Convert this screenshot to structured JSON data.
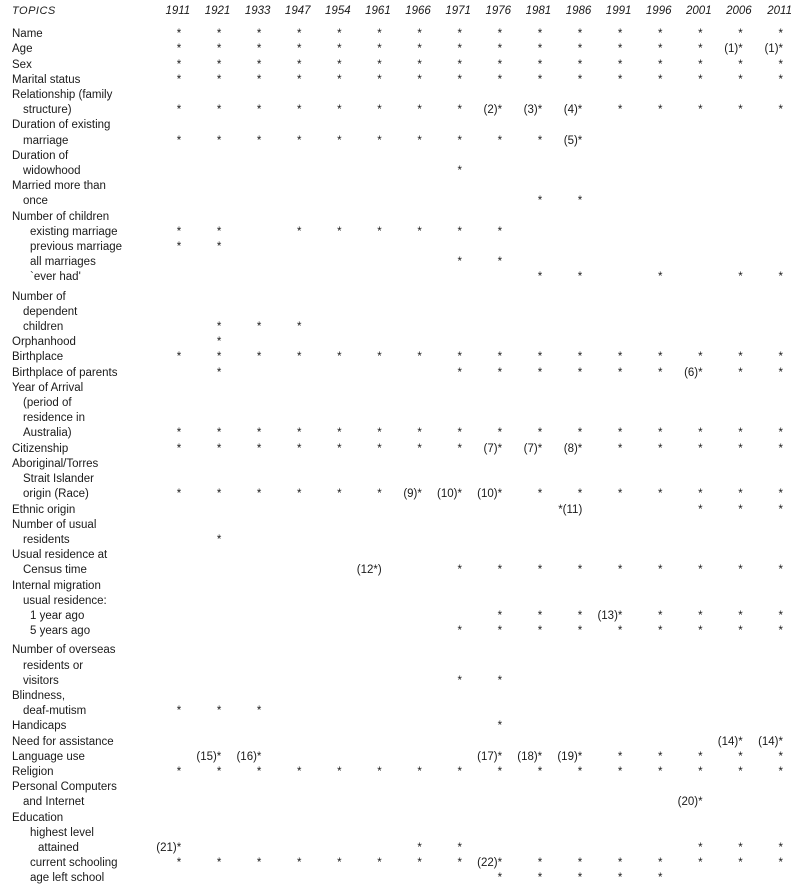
{
  "header": {
    "topics_label": "TOPICS",
    "years": [
      "1911",
      "1921",
      "1933",
      "1947",
      "1954",
      "1961",
      "1966",
      "1971",
      "1976",
      "1981",
      "1986",
      "1991",
      "1996",
      "2001",
      "2006",
      "2011"
    ]
  },
  "rows": [
    {
      "label": "Name",
      "indent": 0,
      "values": [
        "*",
        "*",
        "*",
        "*",
        "*",
        "*",
        "*",
        "*",
        "*",
        "*",
        "*",
        "*",
        "*",
        "*",
        "*",
        "*"
      ]
    },
    {
      "label": "Age",
      "indent": 0,
      "values": [
        "*",
        "*",
        "*",
        "*",
        "*",
        "*",
        "*",
        "*",
        "*",
        "*",
        "*",
        "*",
        "*",
        "*",
        "(1)*",
        "(1)*"
      ]
    },
    {
      "label": "Sex",
      "indent": 0,
      "values": [
        "*",
        "*",
        "*",
        "*",
        "*",
        "*",
        "*",
        "*",
        "*",
        "*",
        "*",
        "*",
        "*",
        "*",
        "*",
        "*"
      ]
    },
    {
      "label": "Marital status",
      "indent": 0,
      "values": [
        "*",
        "*",
        "*",
        "*",
        "*",
        "*",
        "*",
        "*",
        "*",
        "*",
        "*",
        "*",
        "*",
        "*",
        "*",
        "*"
      ]
    },
    {
      "label": "Relationship (family",
      "indent": 0,
      "values": [
        "",
        "",
        "",
        "",
        "",
        "",
        "",
        "",
        "",
        "",
        "",
        "",
        "",
        "",
        "",
        ""
      ]
    },
    {
      "label": "structure)",
      "indent": 1,
      "values": [
        "*",
        "*",
        "*",
        "*",
        "*",
        "*",
        "*",
        "*",
        "(2)*",
        "(3)*",
        "(4)*",
        "*",
        "*",
        "*",
        "*",
        "*"
      ]
    },
    {
      "label": "Duration of existing",
      "indent": 0,
      "values": [
        "",
        "",
        "",
        "",
        "",
        "",
        "",
        "",
        "",
        "",
        "",
        "",
        "",
        "",
        "",
        ""
      ]
    },
    {
      "label": "marriage",
      "indent": 1,
      "values": [
        "*",
        "*",
        "*",
        "*",
        "*",
        "*",
        "*",
        "*",
        "*",
        "*",
        "(5)*",
        "",
        "",
        "",
        "",
        ""
      ]
    },
    {
      "label": "Duration of",
      "indent": 0,
      "values": [
        "",
        "",
        "",
        "",
        "",
        "",
        "",
        "",
        "",
        "",
        "",
        "",
        "",
        "",
        "",
        ""
      ]
    },
    {
      "label": "widowhood",
      "indent": 1,
      "values": [
        "",
        "",
        "",
        "",
        "",
        "",
        "",
        "*",
        "",
        "",
        "",
        "",
        "",
        "",
        "",
        ""
      ]
    },
    {
      "label": "Married more than",
      "indent": 0,
      "values": [
        "",
        "",
        "",
        "",
        "",
        "",
        "",
        "",
        "",
        "",
        "",
        "",
        "",
        "",
        "",
        ""
      ]
    },
    {
      "label": "once",
      "indent": 1,
      "values": [
        "",
        "",
        "",
        "",
        "",
        "",
        "",
        "",
        "",
        "*",
        "*",
        "",
        "",
        "",
        "",
        ""
      ]
    },
    {
      "label": "Number of children",
      "indent": 0,
      "values": [
        "",
        "",
        "",
        "",
        "",
        "",
        "",
        "",
        "",
        "",
        "",
        "",
        "",
        "",
        "",
        ""
      ]
    },
    {
      "label": "existing marriage",
      "indent": 2,
      "values": [
        "*",
        "*",
        "",
        "*",
        "*",
        "*",
        "*",
        "*",
        "*",
        "",
        "",
        "",
        "",
        "",
        "",
        ""
      ]
    },
    {
      "label": "previous marriage",
      "indent": 2,
      "values": [
        "*",
        "*",
        "",
        "",
        "",
        "",
        "",
        "",
        "",
        "",
        "",
        "",
        "",
        "",
        "",
        ""
      ]
    },
    {
      "label": "all marriages",
      "indent": 2,
      "values": [
        "",
        "",
        "",
        "",
        "",
        "",
        "",
        "*",
        "*",
        "",
        "",
        "",
        "",
        "",
        "",
        ""
      ]
    },
    {
      "label": "`ever had'",
      "indent": 2,
      "values": [
        "",
        "",
        "",
        "",
        "",
        "",
        "",
        "",
        "",
        "*",
        "*",
        "",
        "*",
        "",
        "*",
        "*"
      ]
    },
    {
      "label": "Number of",
      "indent": 0,
      "gap": true,
      "values": [
        "",
        "",
        "",
        "",
        "",
        "",
        "",
        "",
        "",
        "",
        "",
        "",
        "",
        "",
        "",
        ""
      ]
    },
    {
      "label": "dependent",
      "indent": 1,
      "values": [
        "",
        "",
        "",
        "",
        "",
        "",
        "",
        "",
        "",
        "",
        "",
        "",
        "",
        "",
        "",
        ""
      ]
    },
    {
      "label": "children",
      "indent": 1,
      "values": [
        "",
        "*",
        "*",
        "*",
        "",
        "",
        "",
        "",
        "",
        "",
        "",
        "",
        "",
        "",
        "",
        ""
      ]
    },
    {
      "label": "Orphanhood",
      "indent": 0,
      "values": [
        "",
        "*",
        "",
        "",
        "",
        "",
        "",
        "",
        "",
        "",
        "",
        "",
        "",
        "",
        "",
        ""
      ]
    },
    {
      "label": "Birthplace",
      "indent": 0,
      "values": [
        "*",
        "*",
        "*",
        "*",
        "*",
        "*",
        "*",
        "*",
        "*",
        "*",
        "*",
        "*",
        "*",
        "*",
        "*",
        "*"
      ]
    },
    {
      "label": "Birthplace of parents",
      "indent": 0,
      "values": [
        "",
        "*",
        "",
        "",
        "",
        "",
        "",
        "*",
        "*",
        "*",
        "*",
        "*",
        "*",
        "(6)*",
        "*",
        "*"
      ]
    },
    {
      "label": "Year of Arrival",
      "indent": 0,
      "values": [
        "",
        "",
        "",
        "",
        "",
        "",
        "",
        "",
        "",
        "",
        "",
        "",
        "",
        "",
        "",
        ""
      ]
    },
    {
      "label": "(period of",
      "indent": 1,
      "values": [
        "",
        "",
        "",
        "",
        "",
        "",
        "",
        "",
        "",
        "",
        "",
        "",
        "",
        "",
        "",
        ""
      ]
    },
    {
      "label": "residence in",
      "indent": 1,
      "values": [
        "",
        "",
        "",
        "",
        "",
        "",
        "",
        "",
        "",
        "",
        "",
        "",
        "",
        "",
        "",
        ""
      ]
    },
    {
      "label": "Australia)",
      "indent": 1,
      "values": [
        "*",
        "*",
        "*",
        "*",
        "*",
        "*",
        "*",
        "*",
        "*",
        "*",
        "*",
        "*",
        "*",
        "*",
        "*",
        "*"
      ]
    },
    {
      "label": "Citizenship",
      "indent": 0,
      "values": [
        "*",
        "*",
        "*",
        "*",
        "*",
        "*",
        "*",
        "*",
        "(7)*",
        "(7)*",
        "(8)*",
        "*",
        "*",
        "*",
        "*",
        "*"
      ]
    },
    {
      "label": "Aboriginal/Torres",
      "indent": 0,
      "values": [
        "",
        "",
        "",
        "",
        "",
        "",
        "",
        "",
        "",
        "",
        "",
        "",
        "",
        "",
        "",
        ""
      ]
    },
    {
      "label": "Strait Islander",
      "indent": 1,
      "values": [
        "",
        "",
        "",
        "",
        "",
        "",
        "",
        "",
        "",
        "",
        "",
        "",
        "",
        "",
        "",
        ""
      ]
    },
    {
      "label": "origin (Race)",
      "indent": 1,
      "values": [
        "*",
        "*",
        "*",
        "*",
        "*",
        "*",
        "(9)*",
        "(10)*",
        "(10)*",
        "*",
        "*",
        "*",
        "*",
        "*",
        "*",
        "*"
      ]
    },
    {
      "label": "Ethnic origin",
      "indent": 0,
      "values": [
        "",
        "",
        "",
        "",
        "",
        "",
        "",
        "",
        "",
        "",
        "*(11)",
        "",
        "",
        "*",
        "*",
        "*"
      ]
    },
    {
      "label": "Number of usual",
      "indent": 0,
      "values": [
        "",
        "",
        "",
        "",
        "",
        "",
        "",
        "",
        "",
        "",
        "",
        "",
        "",
        "",
        "",
        ""
      ]
    },
    {
      "label": "residents",
      "indent": 1,
      "values": [
        "",
        "*",
        "",
        "",
        "",
        "",
        "",
        "",
        "",
        "",
        "",
        "",
        "",
        "",
        "",
        ""
      ]
    },
    {
      "label": "Usual residence at",
      "indent": 0,
      "values": [
        "",
        "",
        "",
        "",
        "",
        "",
        "",
        "",
        "",
        "",
        "",
        "",
        "",
        "",
        "",
        ""
      ]
    },
    {
      "label": "Census time",
      "indent": 1,
      "values": [
        "",
        "",
        "",
        "",
        "",
        "(12*)",
        "",
        "*",
        "*",
        "*",
        "*",
        "*",
        "*",
        "*",
        "*",
        "*"
      ]
    },
    {
      "label": "Internal migration",
      "indent": 0,
      "values": [
        "",
        "",
        "",
        "",
        "",
        "",
        "",
        "",
        "",
        "",
        "",
        "",
        "",
        "",
        "",
        ""
      ]
    },
    {
      "label": "usual residence:",
      "indent": 1,
      "values": [
        "",
        "",
        "",
        "",
        "",
        "",
        "",
        "",
        "",
        "",
        "",
        "",
        "",
        "",
        "",
        ""
      ]
    },
    {
      "label": "1 year ago",
      "indent": 2,
      "values": [
        "",
        "",
        "",
        "",
        "",
        "",
        "",
        "",
        "*",
        "*",
        "*",
        "(13)*",
        "*",
        "*",
        "*",
        "*"
      ]
    },
    {
      "label": "5 years ago",
      "indent": 2,
      "values": [
        "",
        "",
        "",
        "",
        "",
        "",
        "",
        "*",
        "*",
        "*",
        "*",
        "*",
        "*",
        "*",
        "*",
        "*"
      ]
    },
    {
      "label": "Number of overseas",
      "indent": 0,
      "gap": true,
      "values": [
        "",
        "",
        "",
        "",
        "",
        "",
        "",
        "",
        "",
        "",
        "",
        "",
        "",
        "",
        "",
        ""
      ]
    },
    {
      "label": "residents or",
      "indent": 1,
      "values": [
        "",
        "",
        "",
        "",
        "",
        "",
        "",
        "",
        "",
        "",
        "",
        "",
        "",
        "",
        "",
        ""
      ]
    },
    {
      "label": "visitors",
      "indent": 1,
      "values": [
        "",
        "",
        "",
        "",
        "",
        "",
        "",
        "*",
        "*",
        "",
        "",
        "",
        "",
        "",
        "",
        ""
      ]
    },
    {
      "label": "Blindness,",
      "indent": 0,
      "values": [
        "",
        "",
        "",
        "",
        "",
        "",
        "",
        "",
        "",
        "",
        "",
        "",
        "",
        "",
        "",
        ""
      ]
    },
    {
      "label": "deaf-mutism",
      "indent": 1,
      "values": [
        "*",
        "*",
        "*",
        "",
        "",
        "",
        "",
        "",
        "",
        "",
        "",
        "",
        "",
        "",
        "",
        ""
      ]
    },
    {
      "label": "Handicaps",
      "indent": 0,
      "values": [
        "",
        "",
        "",
        "",
        "",
        "",
        "",
        "",
        "*",
        "",
        "",
        "",
        "",
        "",
        "",
        ""
      ]
    },
    {
      "label": "Need for assistance",
      "indent": 0,
      "values": [
        "",
        "",
        "",
        "",
        "",
        "",
        "",
        "",
        "",
        "",
        "",
        "",
        "",
        "",
        "(14)*",
        "(14)*"
      ]
    },
    {
      "label": "Language use",
      "indent": 0,
      "values": [
        "",
        "(15)*",
        "(16)*",
        "",
        "",
        "",
        "",
        "",
        "(17)*",
        "(18)*",
        "(19)*",
        "*",
        "*",
        "*",
        "*",
        "*"
      ]
    },
    {
      "label": "Religion",
      "indent": 0,
      "values": [
        "*",
        "*",
        "*",
        "*",
        "*",
        "*",
        "*",
        "*",
        "*",
        "*",
        "*",
        "*",
        "*",
        "*",
        "*",
        "*"
      ]
    },
    {
      "label": "Personal Computers",
      "indent": 0,
      "values": [
        "",
        "",
        "",
        "",
        "",
        "",
        "",
        "",
        "",
        "",
        "",
        "",
        "",
        "",
        "",
        ""
      ]
    },
    {
      "label": "and Internet",
      "indent": 1,
      "values": [
        "",
        "",
        "",
        "",
        "",
        "",
        "",
        "",
        "",
        "",
        "",
        "",
        "",
        "(20)*",
        "",
        ""
      ]
    },
    {
      "label": "Education",
      "indent": 0,
      "values": [
        "",
        "",
        "",
        "",
        "",
        "",
        "",
        "",
        "",
        "",
        "",
        "",
        "",
        "",
        "",
        ""
      ]
    },
    {
      "label": "highest level",
      "indent": 2,
      "values": [
        "",
        "",
        "",
        "",
        "",
        "",
        "",
        "",
        "",
        "",
        "",
        "",
        "",
        "",
        "",
        ""
      ]
    },
    {
      "label": "attained",
      "indent": 3,
      "values": [
        "(21)*",
        "",
        "",
        "",
        "",
        "",
        "*",
        "*",
        "",
        "",
        "",
        "",
        "",
        "*",
        "*",
        "*"
      ]
    },
    {
      "label": "current schooling",
      "indent": 2,
      "values": [
        "*",
        "*",
        "*",
        "*",
        "*",
        "*",
        "*",
        "*",
        "(22)*",
        "*",
        "*",
        "*",
        "*",
        "*",
        "*",
        "*"
      ]
    },
    {
      "label": "age left school",
      "indent": 2,
      "values": [
        "",
        "",
        "",
        "",
        "",
        "",
        "",
        "",
        "*",
        "*",
        "*",
        "*",
        "*",
        "",
        "",
        ""
      ]
    }
  ]
}
